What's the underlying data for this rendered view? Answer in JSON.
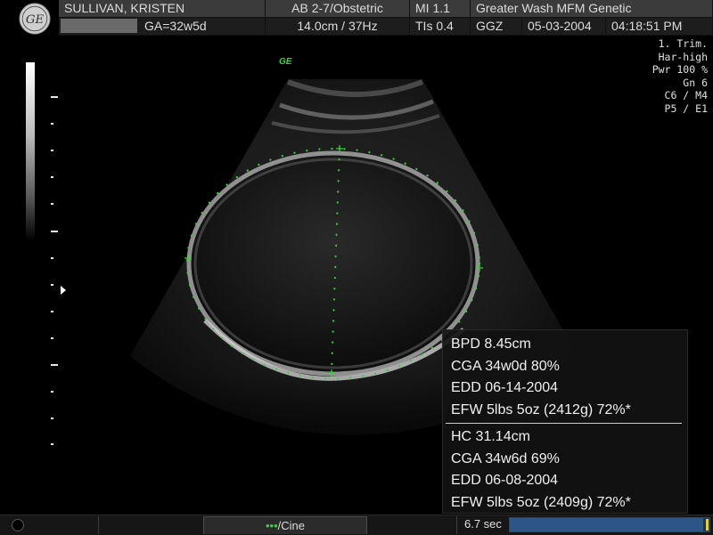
{
  "header": {
    "patient_name": "SULLIVAN, KRISTEN",
    "gestational_age": "GA=32w5d",
    "probe_preset": "AB 2-7/Obstetric",
    "depth_frequency": "14.0cm / 37Hz",
    "mi": "MI  1.1",
    "tis": "TIs  0.4",
    "institution": "Greater Wash MFM Genetic",
    "operator": "GGZ",
    "date": "05-03-2004",
    "time": "04:18:51 PM"
  },
  "params": [
    "1. Trim.",
    "Har-high",
    "Pwr 100 %",
    "Gn   6",
    "C6 / M4",
    "P5 / E1"
  ],
  "ge_tag": "GE",
  "measurements": {
    "bpd_group": [
      "BPD 8.45cm",
      "CGA 34w0d 80%",
      "EDD 06-14-2004",
      "EFW 5lbs 5oz (2412g) 72%*"
    ],
    "hc_group": [
      "HC 31.14cm",
      "CGA 34w6d 69%",
      "EDD 06-08-2004",
      "EFW 5lbs 5oz (2409g) 72%*"
    ]
  },
  "bottom": {
    "cine_dots": "•••",
    "cine_label": "/Cine",
    "seconds": "6.7 sec",
    "cine_progress": 0.97
  },
  "colors": {
    "caliper_green": "#3ad23a",
    "header_bg": "#3b3b3b",
    "progress_blue": "#2d5585"
  },
  "icons": [
    "ge-logo-icon",
    "focus-marker-icon",
    "caliper-icon"
  ]
}
